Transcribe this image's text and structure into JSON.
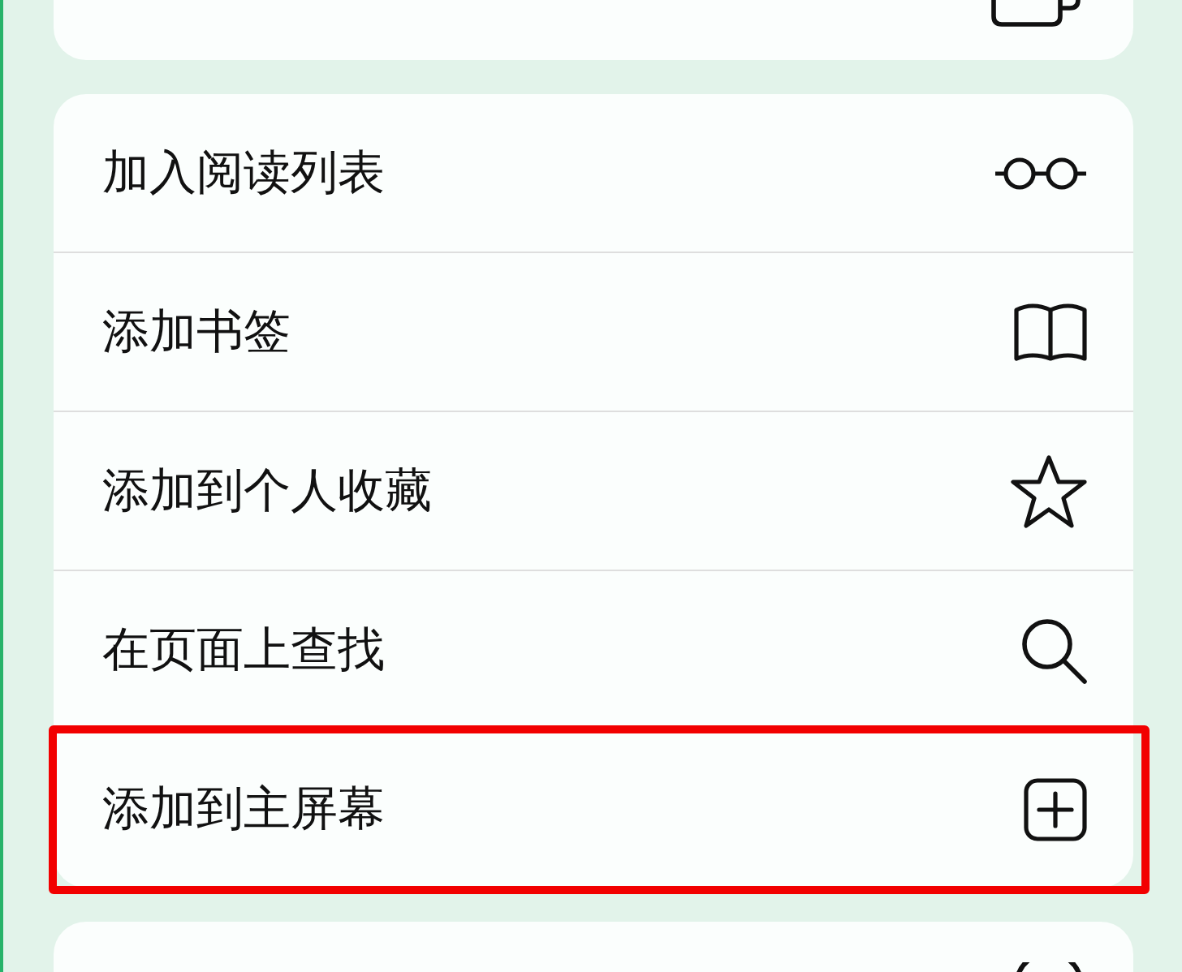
{
  "menu": [
    {
      "label": "加入阅读列表",
      "highlighted": false
    },
    {
      "label": "添加书签",
      "highlighted": false
    },
    {
      "label": "添加到个人收藏",
      "highlighted": false
    },
    {
      "label": "在页面上查找",
      "highlighted": false
    },
    {
      "label": "添加到主屏幕",
      "highlighted": true
    }
  ]
}
